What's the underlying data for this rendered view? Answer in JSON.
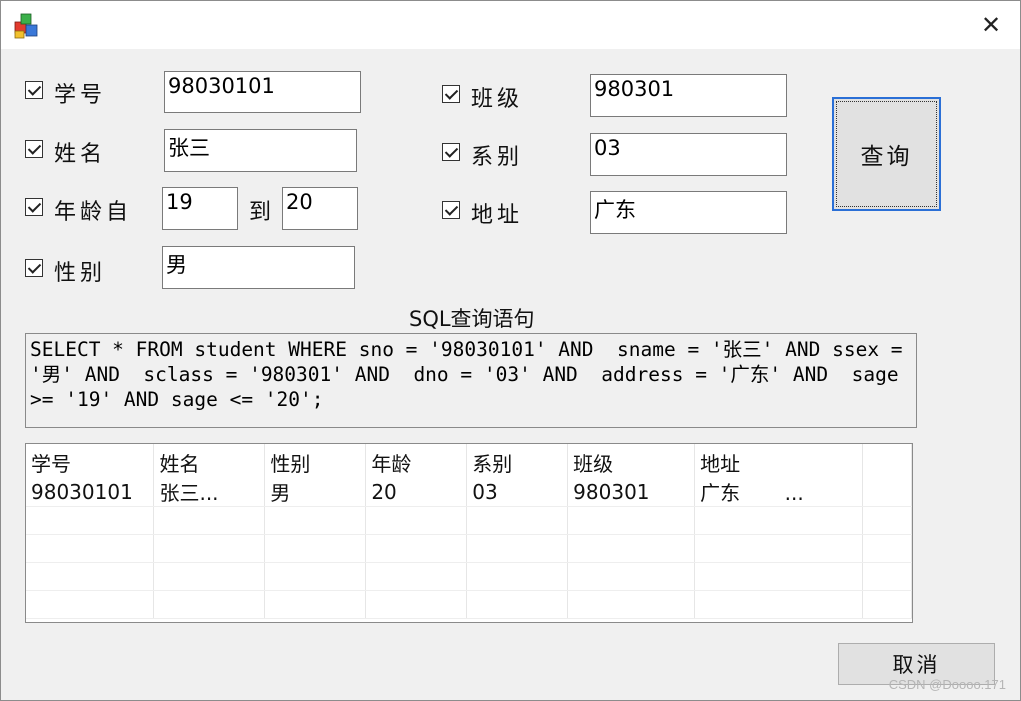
{
  "titlebar": {
    "close_glyph": "✕"
  },
  "filters": {
    "student_no": {
      "label": "学号",
      "value": "98030101",
      "checked": true
    },
    "name": {
      "label": "姓名",
      "value": "张三",
      "checked": true
    },
    "age": {
      "label": "年龄自",
      "from": "19",
      "to_label": "到",
      "to": "20",
      "checked": true
    },
    "gender": {
      "label": "性别",
      "value": "男",
      "checked": true
    },
    "class": {
      "label": "班级",
      "value": "980301",
      "checked": true
    },
    "dept": {
      "label": "系别",
      "value": "03",
      "checked": true
    },
    "address": {
      "label": "地址",
      "value": "广东",
      "checked": true
    }
  },
  "query_button": "查询",
  "sql": {
    "title": "SQL查询语句",
    "text": "SELECT * FROM student WHERE sno = '98030101' AND  sname = '张三' AND ssex = '男' AND  sclass = '980301' AND  dno = '03' AND  address = '广东' AND  sage >= '19' AND sage <= '20';"
  },
  "grid": {
    "columns": [
      "学号",
      "姓名",
      "性别",
      "年龄",
      "系别",
      "班级",
      "地址"
    ],
    "rows": [
      [
        "98030101",
        "张三...",
        "男",
        "20",
        "03",
        "980301",
        "广东       ..."
      ]
    ]
  },
  "cancel_button": "取消",
  "watermark": "CSDN @Doooo.171"
}
